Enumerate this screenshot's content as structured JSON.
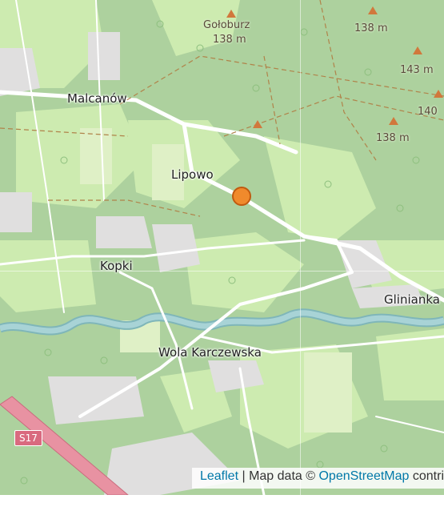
{
  "map": {
    "places": [
      {
        "id": "malcanow",
        "label": "Malcanów"
      },
      {
        "id": "lipowo",
        "label": "Lipowo"
      },
      {
        "id": "kopki",
        "label": "Kopki"
      },
      {
        "id": "glinianka",
        "label": "Glinianka"
      },
      {
        "id": "wola",
        "label": "Wola Karczewska"
      }
    ],
    "peaks": [
      {
        "id": "goloburz",
        "name": "Gołoburz",
        "elevation": "138 m"
      },
      {
        "id": "peak-ne1",
        "elevation": "138 m"
      },
      {
        "id": "peak-e1",
        "elevation": "143 m"
      },
      {
        "id": "peak-e2",
        "elevation": "140"
      },
      {
        "id": "peak-e3",
        "elevation": "138 m"
      }
    ],
    "road_ref": "S17",
    "marker_color": "#f08a2c",
    "colors": {
      "forest": "#add19e",
      "meadow": "#cdebb0",
      "residential": "#e0dfdf",
      "river": "#a8d3d6",
      "motorway": "#e892a2"
    }
  },
  "attribution": {
    "leaflet": "Leaflet",
    "separator": " | Map data © ",
    "osm": "OpenStreetMap",
    "tail": " contri"
  }
}
